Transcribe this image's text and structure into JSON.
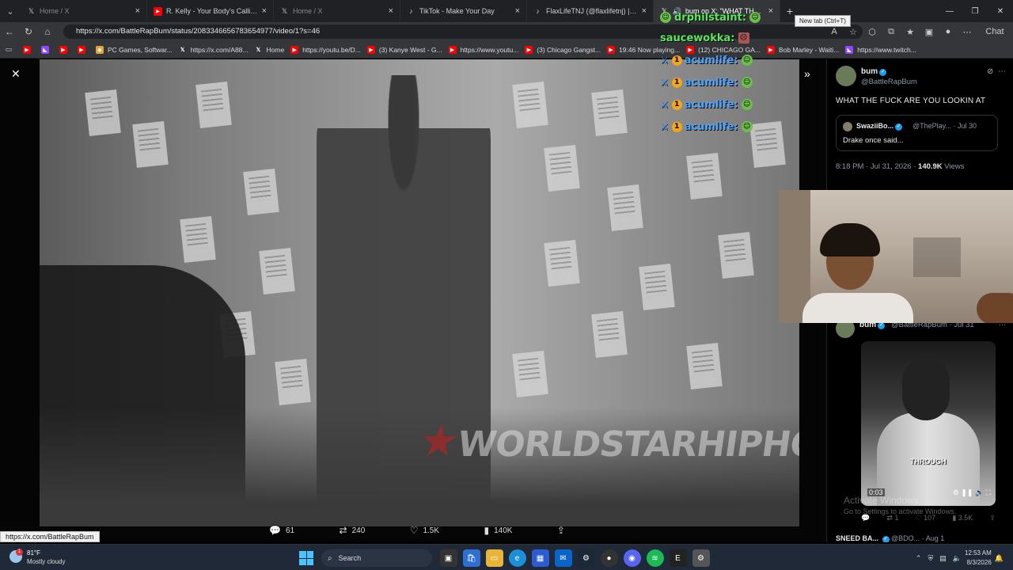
{
  "browser": {
    "tabs": [
      {
        "title": "Home / X",
        "favicon": "x-icon",
        "dim": true
      },
      {
        "title": "R. Kelly - Your Body's Callin (Medi",
        "favicon": "youtube-icon",
        "dim": false
      },
      {
        "title": "Home / X",
        "favicon": "x-icon",
        "dim": true
      },
      {
        "title": "TikTok - Make Your Day",
        "favicon": "tiktok-icon",
        "dim": false
      },
      {
        "title": "FlaxLifeTNJ (@flaxlifetnj) | TikTok",
        "favicon": "tiktok-icon",
        "dim": false
      },
      {
        "title": "bum on X: \"WHAT THE FUCK",
        "favicon": "x-icon",
        "dim": false,
        "active": true
      }
    ],
    "newtab_tooltip": "New tab (Ctrl+T)",
    "url": "https://x.com/BattleRapBum/status/2083346656783654977/video/1?s=46",
    "chat_label": "Chat",
    "bookmarks": [
      {
        "label": "",
        "icon": "youtube-icon"
      },
      {
        "label": "",
        "icon": "twitch-icon"
      },
      {
        "label": "",
        "icon": "youtube-icon"
      },
      {
        "label": "",
        "icon": "youtube-icon"
      },
      {
        "label": "PC Games, Softwar...",
        "icon": "game-icon"
      },
      {
        "label": "https://x.com/A88...",
        "icon": "x-icon"
      },
      {
        "label": "Home",
        "icon": "x-icon"
      },
      {
        "label": "https://youtu.be/D...",
        "icon": "youtube-icon"
      },
      {
        "label": "(3) Kanye West - G...",
        "icon": "youtube-icon"
      },
      {
        "label": "https://www.youtu...",
        "icon": "youtube-icon"
      },
      {
        "label": "(3) Chicago Gangst...",
        "icon": "youtube-icon"
      },
      {
        "label": "19:46 Now playing...",
        "icon": "youtube-icon"
      },
      {
        "label": "(12) CHICAGO GA...",
        "icon": "youtube-icon"
      },
      {
        "label": "Bob Marley - Waiti...",
        "icon": "youtube-icon"
      },
      {
        "label": "https://www.twitch...",
        "icon": "twitch-icon"
      }
    ],
    "status_url": "https://x.com/BattleRapBum"
  },
  "video": {
    "watermark_left": "WORLDSTAR",
    "watermark_right": "HIPHOP.COM",
    "actions": {
      "replies": "61",
      "reposts": "240",
      "likes": "1.5K",
      "views": "140K"
    }
  },
  "chat_overlay": [
    {
      "user": "drphilstaint:",
      "color": "green",
      "badge": false
    },
    {
      "user": "saucewokka:",
      "color": "green",
      "badge": false
    },
    {
      "user": "acumlife:",
      "color": "blue",
      "badge": true
    },
    {
      "user": "acumlife:",
      "color": "blue",
      "badge": true
    },
    {
      "user": "acumlife:",
      "color": "blue",
      "badge": true
    },
    {
      "user": "acumlife:",
      "color": "blue",
      "badge": true
    }
  ],
  "sidebar": {
    "post": {
      "name": "bum",
      "handle": "@BattleRapBum",
      "text": "WHAT THE FUCK ARE YOU LOOKIN AT",
      "quote": {
        "name": "SwaziiBo...",
        "handle": "@ThePlay... · Jul 30",
        "text": "Drake once said..."
      },
      "time": "8:18 PM · Jul 31, 2026 · ",
      "views_count": "140.9K",
      "views_label": " Views"
    },
    "reply": {
      "name": "bum",
      "handle": "@BattleRapBum · Jul 31",
      "thumb_caption": "THROUGH",
      "thumb_duration": "0:03",
      "actions": [
        "1",
        "107",
        "3.5K"
      ]
    },
    "activate_title": "Activate Windows",
    "activate_sub": "Go to Settings to activate Windows.",
    "next_name": "SNEED BA...",
    "next_handle": "@BDO... · Aug 1"
  },
  "taskbar": {
    "temp": "81°F",
    "condition": "Mostly cloudy",
    "search": "Search",
    "time": "12:53 AM",
    "date": "8/3/2026"
  }
}
